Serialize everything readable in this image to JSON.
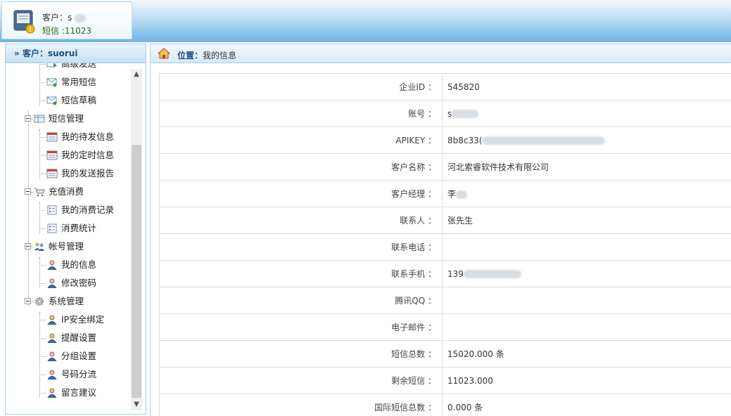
{
  "header": {
    "customer_label": "客户：",
    "customer_visible": "s",
    "sms_label": "短信 :",
    "sms_count": "11023"
  },
  "sidebar": {
    "title": "客户：suorui",
    "items": [
      {
        "label": "高级发送",
        "level": 2,
        "icon": "send-icon"
      },
      {
        "label": "常用短信",
        "level": 2,
        "icon": "mail-icon"
      },
      {
        "label": "短信草稿",
        "level": 2,
        "icon": "mail-icon"
      },
      {
        "label": "短信管理",
        "level": 1,
        "icon": "table-icon"
      },
      {
        "label": "我的待发信息",
        "level": 2,
        "icon": "calendar-icon"
      },
      {
        "label": "我的定时信息",
        "level": 2,
        "icon": "calendar-icon"
      },
      {
        "label": "我的发送报告",
        "level": 2,
        "icon": "calendar-icon"
      },
      {
        "label": "充值消费",
        "level": 1,
        "icon": "cart-icon"
      },
      {
        "label": "我的消费记录",
        "level": 2,
        "icon": "checklist-icon"
      },
      {
        "label": "消费统计",
        "level": 2,
        "icon": "checklist-icon"
      },
      {
        "label": "帐号管理",
        "level": 1,
        "icon": "users-icon"
      },
      {
        "label": "我的信息",
        "level": 2,
        "icon": "user-icon"
      },
      {
        "label": "修改密码",
        "level": 2,
        "icon": "user-icon"
      },
      {
        "label": "系统管理",
        "level": 1,
        "icon": "gear-icon"
      },
      {
        "label": "IP安全绑定",
        "level": 2,
        "icon": "user-icon"
      },
      {
        "label": "提醒设置",
        "level": 2,
        "icon": "user-icon"
      },
      {
        "label": "分组设置",
        "level": 2,
        "icon": "user-icon"
      },
      {
        "label": "号码分流",
        "level": 2,
        "icon": "user-icon"
      },
      {
        "label": "留言建议",
        "level": 2,
        "icon": "user-icon"
      }
    ]
  },
  "breadcrumb": {
    "label": "位置：",
    "current": "我的信息"
  },
  "info_rows": [
    {
      "key": "企业ID ：",
      "value": "545820"
    },
    {
      "key": "账号 ：",
      "value": "s"
    },
    {
      "key": "APIKEY ：",
      "value": "8b8c33("
    },
    {
      "key": "客户名称 ：",
      "value": "河北索睿软件技术有限公司"
    },
    {
      "key": "客户经理 ：",
      "value": "李"
    },
    {
      "key": "联系人 ：",
      "value": "张先生"
    },
    {
      "key": "联系电话 ：",
      "value": ""
    },
    {
      "key": "联系手机 ：",
      "value": "139"
    },
    {
      "key": "腾讯QQ ：",
      "value": ""
    },
    {
      "key": "电子邮件 ：",
      "value": ""
    },
    {
      "key": "短信总数 ：",
      "value": "15020.000 条"
    },
    {
      "key": "剩余短信 ：",
      "value": "11023.000"
    },
    {
      "key": "国际短信总数 ：",
      "value": "0.000 条"
    }
  ],
  "colors": {
    "header_blue": "#6fb3e4",
    "link_blue": "#1c4f84",
    "sms_green": "#2a6c18",
    "border": "#a9cde9"
  }
}
